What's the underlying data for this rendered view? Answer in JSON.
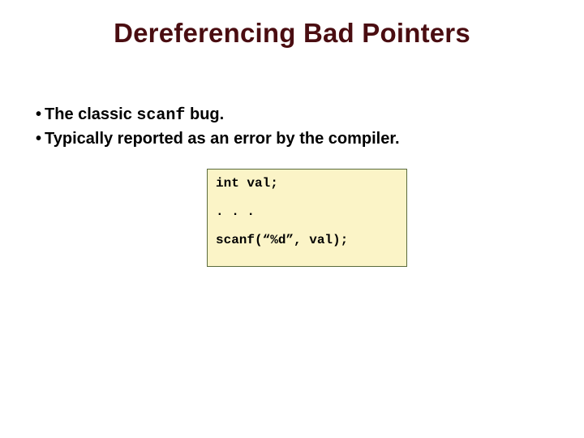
{
  "title": "Dereferencing Bad Pointers",
  "bullets": [
    {
      "prefix": "The classic ",
      "mono": "scanf",
      "suffix": " bug."
    },
    {
      "text": "Typically reported as an error by the compiler."
    }
  ],
  "code": {
    "line1": "int val;",
    "line2": ". . .",
    "line3": "scanf(“%d”, val);"
  }
}
